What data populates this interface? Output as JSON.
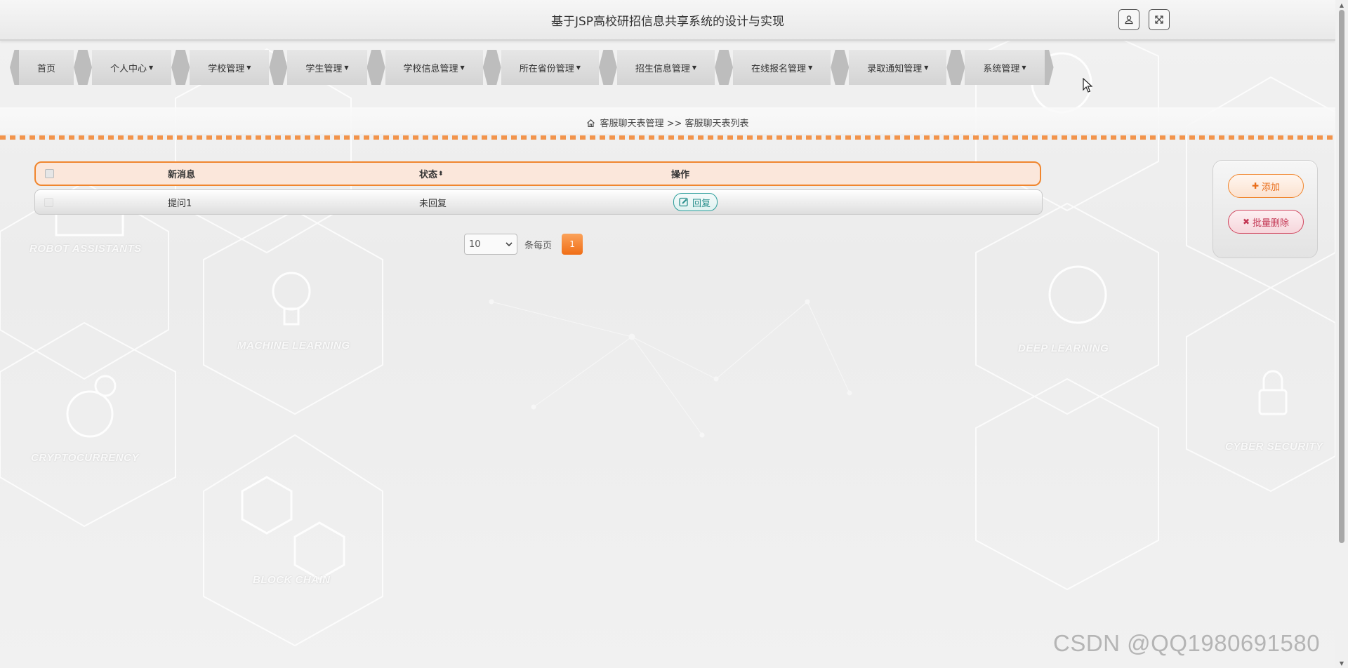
{
  "header": {
    "title": "基于JSP高校研招信息共享系统的设计与实现"
  },
  "nav": {
    "items": [
      {
        "label": "首页",
        "has_dropdown": false
      },
      {
        "label": "个人中心",
        "has_dropdown": true
      },
      {
        "label": "学校管理",
        "has_dropdown": true
      },
      {
        "label": "学生管理",
        "has_dropdown": true
      },
      {
        "label": "学校信息管理",
        "has_dropdown": true
      },
      {
        "label": "所在省份管理",
        "has_dropdown": true
      },
      {
        "label": "招生信息管理",
        "has_dropdown": true
      },
      {
        "label": "在线报名管理",
        "has_dropdown": true
      },
      {
        "label": "录取通知管理",
        "has_dropdown": true
      },
      {
        "label": "系统管理",
        "has_dropdown": true
      }
    ]
  },
  "breadcrumb": {
    "section": "客服聊天表管理",
    "separator": ">>",
    "page": "客服聊天表列表"
  },
  "table": {
    "columns": {
      "message": "新消息",
      "status": "状态",
      "actions": "操作"
    },
    "rows": [
      {
        "message": "提问1",
        "status": "未回复",
        "reply_label": "回复"
      }
    ]
  },
  "pagination": {
    "page_size": "10",
    "page_size_label": "条每页",
    "current_page": "1"
  },
  "actions": {
    "add_label": "添加",
    "batch_delete_label": "批量删除"
  },
  "background_labels": {
    "robot": "ROBOT ASSISTANTS",
    "machine": "MACHINE LEARNING",
    "deep": "DEEP LEARNING",
    "crypto": "CRYPTOCURRENCY",
    "block": "BLOCK CHAIN",
    "cyber": "CYBER SECURITY"
  },
  "watermark": "CSDN @QQ1980691580",
  "colors": {
    "accent": "#f0862e",
    "reply": "#2a9d9a",
    "danger": "#c33653"
  }
}
